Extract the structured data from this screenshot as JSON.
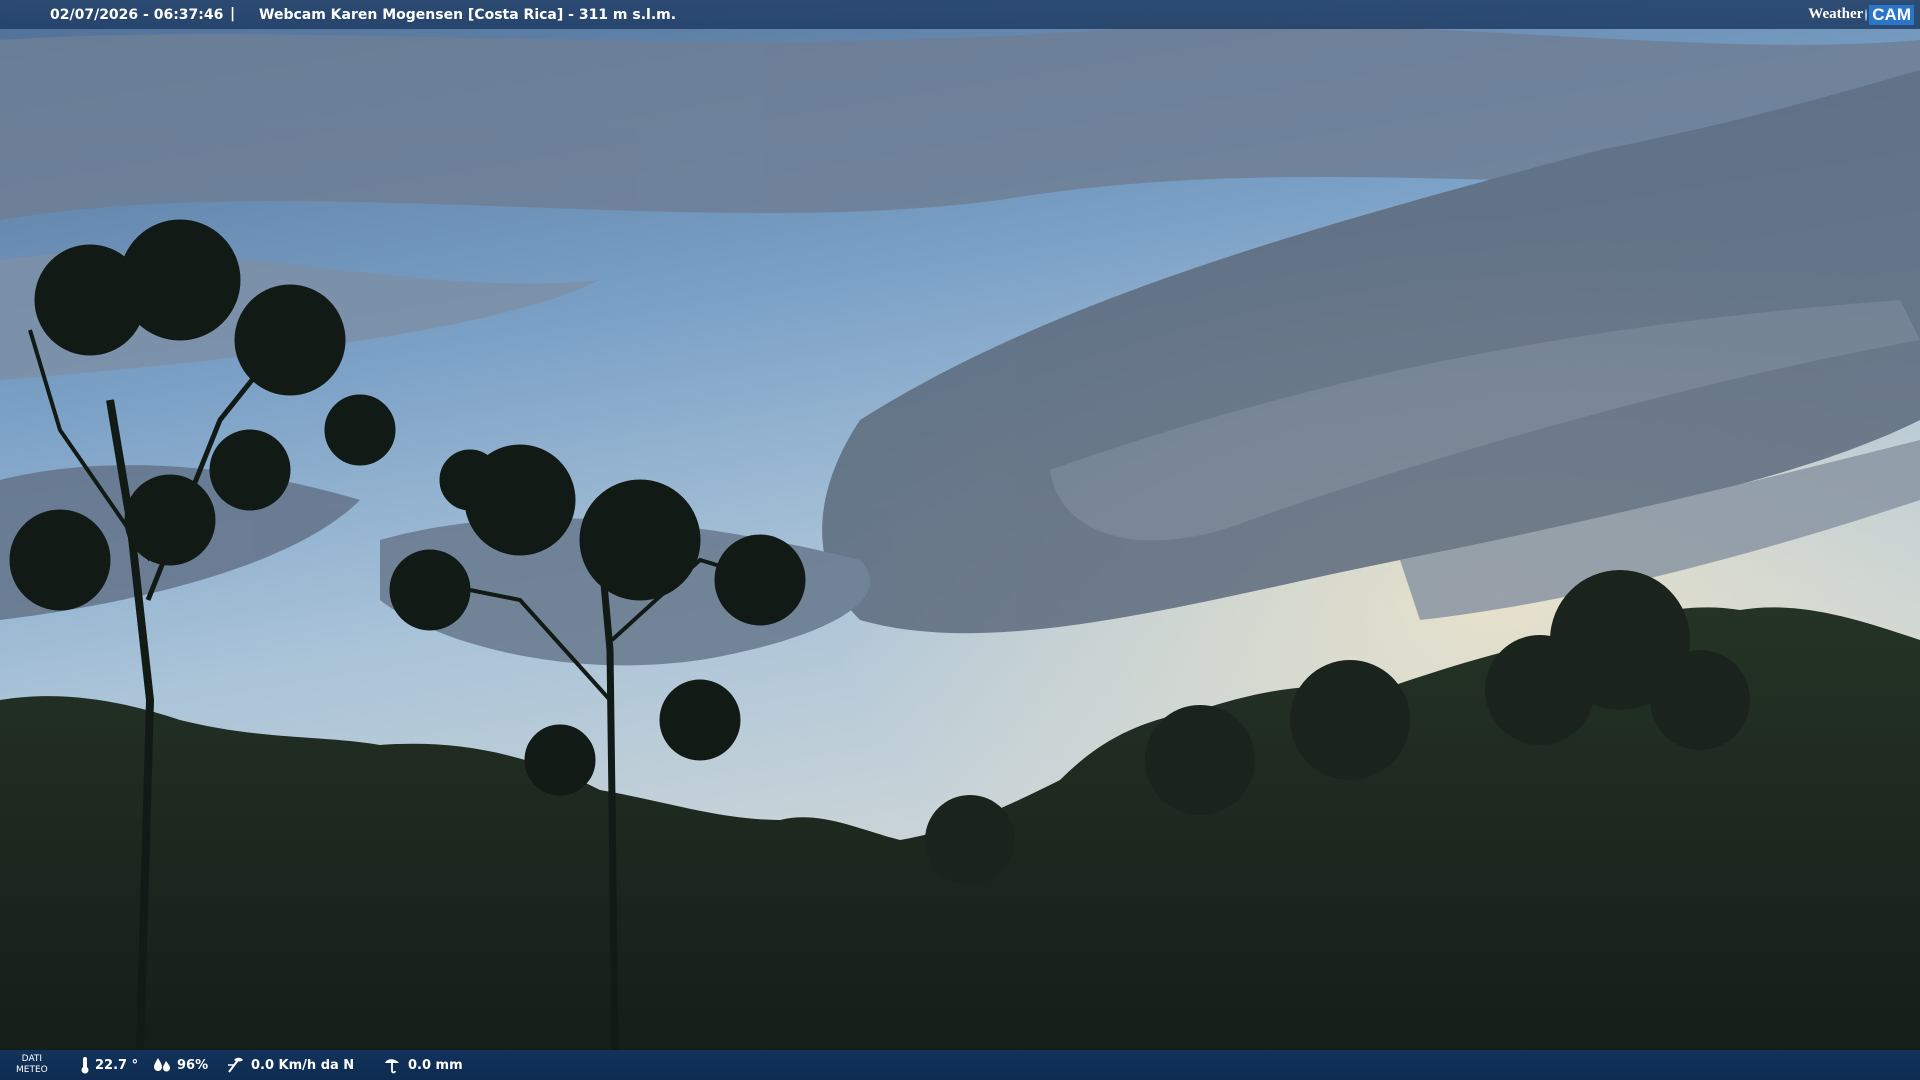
{
  "header": {
    "datetime": "02/07/2026 - 06:37:46",
    "separator": "|",
    "title": "Webcam Karen Mogensen [Costa Rica]  - 311 m s.l.m."
  },
  "logo": {
    "weather": "Weather",
    "cam": "CAM"
  },
  "weather_bar": {
    "label_line1": "DATI",
    "label_line2": "METEO",
    "temperature": "22.7 °",
    "humidity": "96%",
    "wind": "0.0 Km/h da N",
    "rain": "0.0 mm"
  },
  "icons": {
    "temperature": "thermometer-icon",
    "humidity": "humidity-drops-icon",
    "wind": "wind-icon",
    "rain": "rain-gauge-icon"
  },
  "colors": {
    "sky_top": "#5c7fa6",
    "sky_mid": "#8fb3d1",
    "horizon": "#c9d3d6",
    "forest": "#1d2a22",
    "bar": "#163a6a"
  }
}
